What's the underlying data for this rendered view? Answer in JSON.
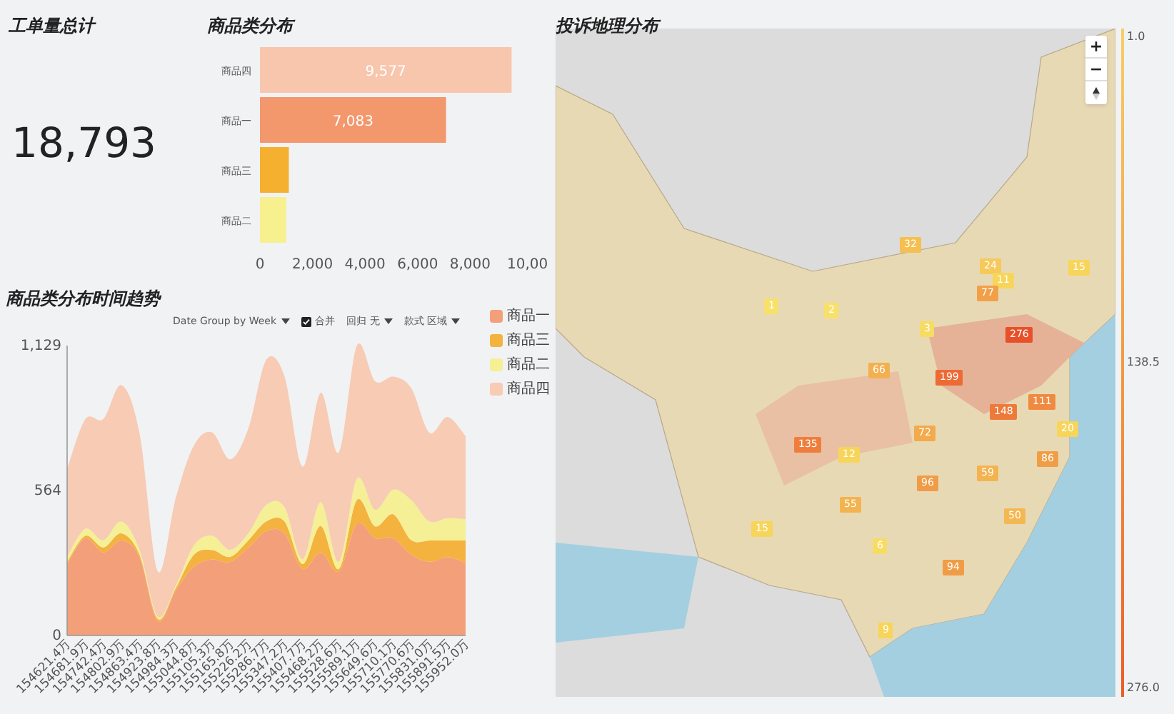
{
  "total": {
    "title": "工单量总计",
    "value": "18,793"
  },
  "category_distribution": {
    "title": "商品类分布",
    "chart_data": {
      "type": "bar",
      "orientation": "horizontal",
      "categories": [
        "商品四",
        "商品一",
        "商品三",
        "商品二"
      ],
      "values": [
        9577,
        7083,
        1100,
        1000
      ],
      "colors": [
        "#f8c6ad",
        "#f3976c",
        "#f5b02f",
        "#f6f08e"
      ],
      "value_labels": [
        "9,577",
        "7,083",
        null,
        null
      ],
      "xticks": [
        {
          "value": 0,
          "label": "0"
        },
        {
          "value": 2000,
          "label": "2,000"
        },
        {
          "value": 4000,
          "label": "4,000"
        },
        {
          "value": 6000,
          "label": "6,000"
        },
        {
          "value": 8000,
          "label": "8,000"
        }
      ],
      "xlim": [
        0,
        9577
      ]
    },
    "cut_tick_label": "10,00"
  },
  "trend": {
    "title": "商品类分布时间趋势",
    "toolbar": [
      {
        "kind": "dropdown",
        "label": "Date Group by Week"
      },
      {
        "kind": "checkbox",
        "label": "合并",
        "checked": true
      },
      {
        "kind": "dropdown",
        "label": "回归 无"
      },
      {
        "kind": "dropdown",
        "label": "款式 区域"
      }
    ],
    "chart_data": {
      "type": "area",
      "stacked": true,
      "ylim": [
        0,
        1129
      ],
      "yticks": [
        {
          "value": 0,
          "label": "0"
        },
        {
          "value": 564,
          "label": "564"
        },
        {
          "value": 1129,
          "label": "1,129"
        }
      ],
      "categories": [
        "154621.4万",
        "154681.9万",
        "154742.4万",
        "154802.9万",
        "154863.4万",
        "154923.8万",
        "154984.3万",
        "155044.8万",
        "155105.3万",
        "155165.8万",
        "155226.2万",
        "155286.7万",
        "155347.2万",
        "155407.7万",
        "155468.2万",
        "155528.6万",
        "155589.1万",
        "155649.6万",
        "155710.1万",
        "155770.6万",
        "155831.0万",
        "155891.5万",
        "155952.0万"
      ],
      "series": [
        {
          "name": "商品一",
          "color": "#f3a07a",
          "values": [
            278,
            379,
            324,
            370,
            305,
            56,
            176,
            268,
            296,
            287,
            342,
            407,
            398,
            259,
            324,
            250,
            435,
            379,
            379,
            315,
            287,
            305,
            283
          ]
        },
        {
          "name": "商品三",
          "color": "#f4b23e",
          "values": [
            9,
            9,
            19,
            28,
            9,
            9,
            9,
            46,
            37,
            19,
            28,
            37,
            46,
            19,
            102,
            9,
            93,
            46,
            93,
            56,
            83,
            65,
            87
          ]
        },
        {
          "name": "商品二",
          "color": "#f5ef96",
          "values": [
            19,
            28,
            28,
            46,
            19,
            9,
            9,
            37,
            56,
            28,
            28,
            65,
            56,
            19,
            93,
            28,
            83,
            65,
            96,
            157,
            74,
            87,
            83
          ]
        },
        {
          "name": "商品四",
          "color": "#f7cbb4",
          "values": [
            342,
            426,
            472,
            531,
            453,
            176,
            342,
            389,
            402,
            352,
            407,
            565,
            509,
            361,
            426,
            426,
            518,
            500,
            440,
            435,
            346,
            394,
            324
          ]
        }
      ]
    }
  },
  "map": {
    "title": "投诉地理分布",
    "zoom_controls": [
      "+",
      "−"
    ],
    "markers": [
      {
        "count": "32",
        "color": "#f5c04f"
      },
      {
        "count": "24",
        "color": "#f5c95a"
      },
      {
        "count": "11",
        "color": "#f7d55a"
      },
      {
        "count": "77",
        "color": "#f2a048"
      },
      {
        "count": "15",
        "color": "#f7d55a"
      },
      {
        "count": "1",
        "color": "#f7e16a"
      },
      {
        "count": "2",
        "color": "#f7e16a"
      },
      {
        "count": "3",
        "color": "#f7dc64"
      },
      {
        "count": "276",
        "color": "#e8502a"
      },
      {
        "count": "66",
        "color": "#f2b050"
      },
      {
        "count": "199",
        "color": "#ec6a34"
      },
      {
        "count": "111",
        "color": "#f08a40"
      },
      {
        "count": "148",
        "color": "#ee7a3a"
      },
      {
        "count": "20",
        "color": "#f7d55a"
      },
      {
        "count": "135",
        "color": "#ef7e3c"
      },
      {
        "count": "12",
        "color": "#f7d55a"
      },
      {
        "count": "72",
        "color": "#f2aa4c"
      },
      {
        "count": "86",
        "color": "#f09e46"
      },
      {
        "count": "59",
        "color": "#f3b450"
      },
      {
        "count": "96",
        "color": "#f09c46"
      },
      {
        "count": "55",
        "color": "#f3b450"
      },
      {
        "count": "50",
        "color": "#f4b852"
      },
      {
        "count": "15",
        "color": "#f7d55a"
      },
      {
        "count": "6",
        "color": "#f7dc64"
      },
      {
        "count": "94",
        "color": "#f09c46"
      },
      {
        "count": "9",
        "color": "#f7d55a"
      }
    ],
    "legend": {
      "labels": [
        "1.0",
        "138.5",
        "276.0"
      ]
    }
  }
}
